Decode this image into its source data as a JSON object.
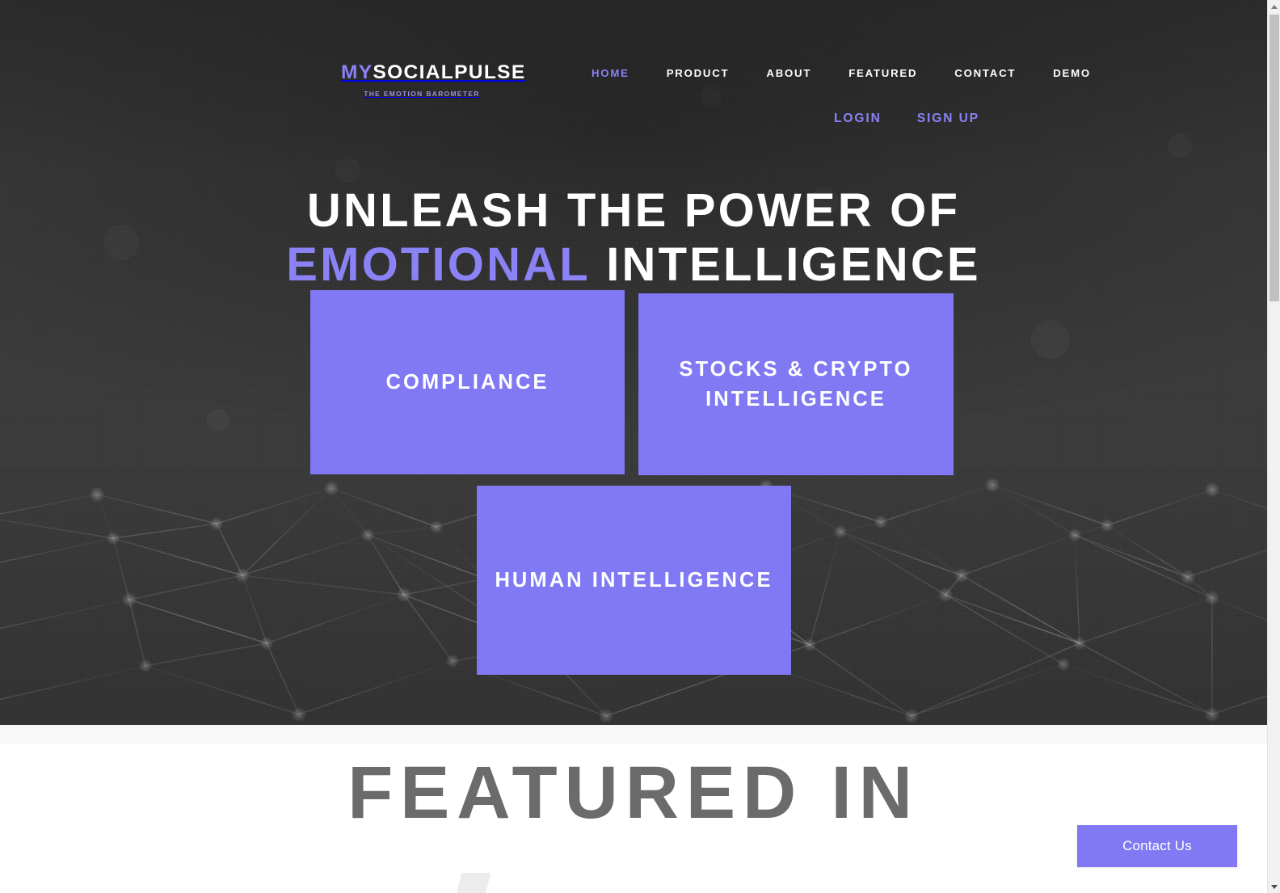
{
  "brand": {
    "logo_prefix": "MY",
    "logo_suffix": "SOCIALPULSE",
    "tagline": "THE EMOTION BAROMETER",
    "accent_color": "#8179f3",
    "accent_light": "#8a82f5"
  },
  "nav": {
    "items": [
      {
        "label": "HOME",
        "active": true
      },
      {
        "label": "PRODUCT",
        "active": false
      },
      {
        "label": "ABOUT",
        "active": false
      },
      {
        "label": "FEATURED",
        "active": false
      },
      {
        "label": "CONTACT",
        "active": false
      },
      {
        "label": "DEMO",
        "active": false
      }
    ],
    "auth": [
      {
        "label": "LOGIN"
      },
      {
        "label": "SIGN UP"
      }
    ]
  },
  "hero": {
    "headline_line1": "UNLEASH THE POWER OF",
    "headline_line2_accent": "EMOTIONAL",
    "headline_line2_rest": "INTELLIGENCE",
    "background_color": "#393939",
    "cards": [
      {
        "label": "COMPLIANCE"
      },
      {
        "label": "STOCKS & CRYPTO INTELLIGENCE"
      },
      {
        "label": "HUMAN INTELLIGENCE"
      }
    ]
  },
  "featured": {
    "title": "FEATURED IN",
    "title_color": "#6b6b6b",
    "background_color": "#ffffff"
  },
  "floating": {
    "contact_label": "Contact Us"
  },
  "scrollbar": {
    "up_arrow": "scroll-up",
    "down_arrow": "scroll-down"
  }
}
